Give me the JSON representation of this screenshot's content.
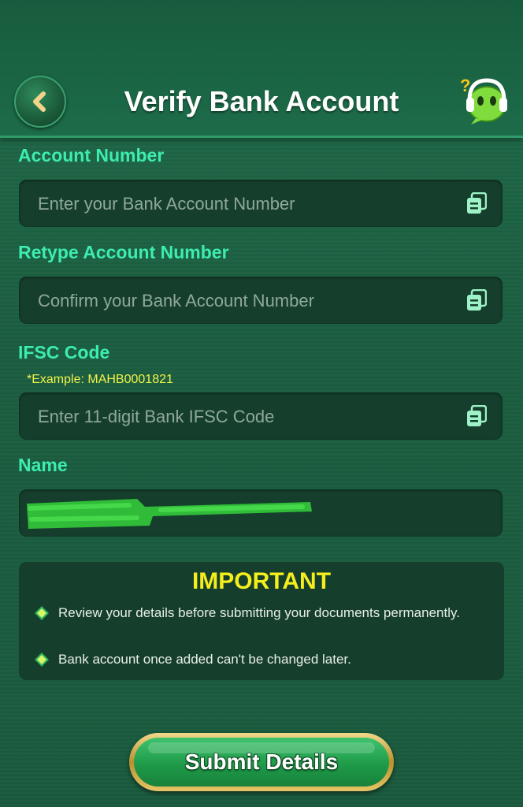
{
  "header": {
    "title": "Verify Bank Account",
    "back_icon": "chevron-left-icon",
    "support_icon": "customer-support-icon"
  },
  "form": {
    "account_number": {
      "label": "Account Number",
      "placeholder": "Enter your Bank Account Number",
      "icon": "paste-icon"
    },
    "retype_account_number": {
      "label": "Retype Account Number",
      "placeholder": "Confirm your Bank Account Number",
      "icon": "paste-icon"
    },
    "ifsc": {
      "label": "IFSC Code",
      "hint": "*Example: MAHB0001821",
      "placeholder": "Enter 11-digit Bank IFSC Code",
      "icon": "paste-icon"
    },
    "name": {
      "label": "Name",
      "value": ""
    }
  },
  "important": {
    "title": "IMPORTANT",
    "items": [
      "Review your details before submitting your documents permanently.",
      "Bank account once added can't be changed later."
    ]
  },
  "submit": {
    "label": "Submit Details"
  },
  "colors": {
    "background": "#1b5e40",
    "label": "#3dedb0",
    "field": "#153f2c",
    "important_title": "#f4ee1c",
    "example_hint": "#f2f24a",
    "button_green": "#1f9a49",
    "button_border": "#d4b355"
  }
}
